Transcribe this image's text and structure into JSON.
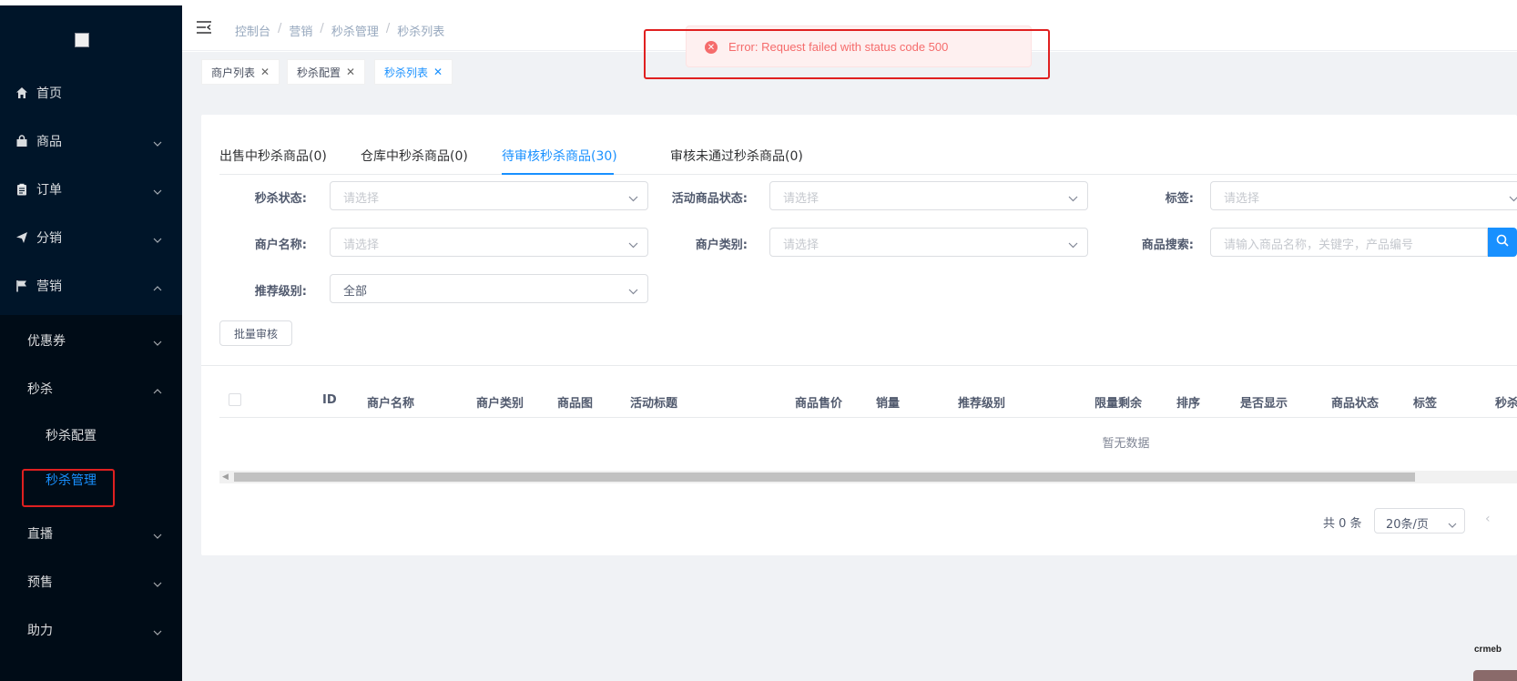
{
  "sidebar": {
    "items": [
      {
        "label": "首页",
        "icon": "home-icon"
      },
      {
        "label": "商品",
        "icon": "bag-icon"
      },
      {
        "label": "订单",
        "icon": "clipboard-icon"
      },
      {
        "label": "分销",
        "icon": "send-icon"
      },
      {
        "label": "营销",
        "icon": "flag-icon"
      }
    ],
    "marketing_sub": [
      {
        "label": "优惠券"
      },
      {
        "label": "秒杀"
      },
      {
        "label": "直播"
      },
      {
        "label": "预售"
      },
      {
        "label": "助力"
      }
    ],
    "seckill_sub": [
      {
        "label": "秒杀配置"
      },
      {
        "label": "秒杀管理"
      }
    ]
  },
  "breadcrumb": [
    "控制台",
    "营销",
    "秒杀管理",
    "秒杀列表"
  ],
  "tags": [
    {
      "label": "商户列表"
    },
    {
      "label": "秒杀配置"
    },
    {
      "label": "秒杀列表"
    }
  ],
  "error_message": "Error: Request failed with status code 500",
  "tabs": [
    "出售中秒杀商品(0)",
    "仓库中秒杀商品(0)",
    "待审核秒杀商品(30)",
    "审核未通过秒杀商品(0)"
  ],
  "filters": {
    "seckill_status": {
      "label": "秒杀状态:",
      "placeholder": "请选择"
    },
    "activity_status": {
      "label": "活动商品状态:",
      "placeholder": "请选择"
    },
    "tag": {
      "label": "标签:",
      "placeholder": "请选择"
    },
    "merchant_name": {
      "label": "商户名称:",
      "placeholder": "请选择"
    },
    "merchant_type": {
      "label": "商户类别:",
      "placeholder": "请选择"
    },
    "product_search": {
      "label": "商品搜索:",
      "placeholder": "请输入商品名称，关键字，产品编号"
    },
    "recommend_level": {
      "label": "推荐级别:",
      "value": "全部"
    }
  },
  "batch_review_label": "批量审核",
  "table": {
    "columns": [
      "ID",
      "商户名称",
      "商户类别",
      "商品图",
      "活动标题",
      "商品售价",
      "销量",
      "推荐级别",
      "限量剩余",
      "排序",
      "是否显示",
      "商品状态",
      "标签",
      "秒杀"
    ],
    "empty_text": "暂无数据"
  },
  "pagination": {
    "total": "共 0 条",
    "page_size": "20条/页"
  },
  "watermark": "crmeb"
}
